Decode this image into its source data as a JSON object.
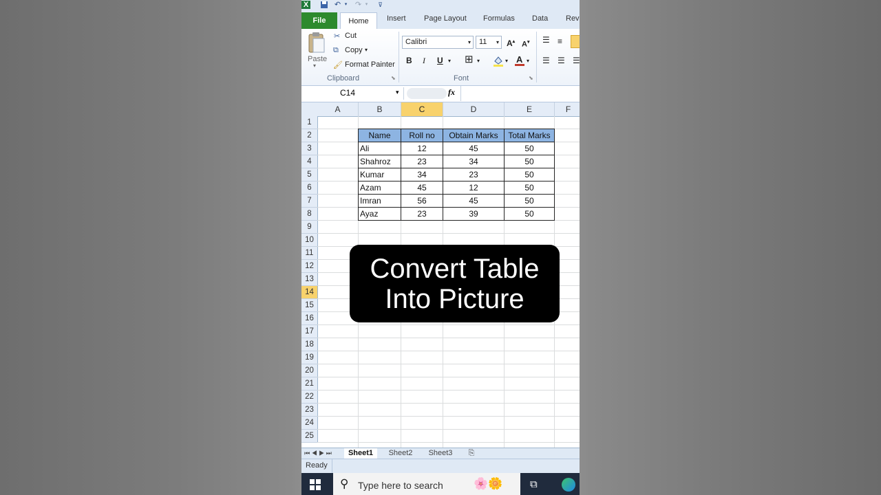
{
  "qat": {
    "save_icon": "save-icon",
    "undo_icon": "undo-icon",
    "redo_icon": "redo-icon",
    "customize_icon": "customize-icon"
  },
  "tabs": {
    "file": "File",
    "home": "Home",
    "insert": "Insert",
    "page_layout": "Page Layout",
    "formulas": "Formulas",
    "data": "Data",
    "review": "Revi"
  },
  "ribbon": {
    "clipboard": {
      "paste": "Paste",
      "cut": "Cut",
      "copy": "Copy",
      "format_painter": "Format Painter",
      "label": "Clipboard"
    },
    "font": {
      "name": "Calibri",
      "size": "11",
      "bold": "B",
      "italic": "I",
      "underline": "U",
      "label": "Font",
      "font_color": "#c0392b",
      "fill_color": "#f7e34c"
    }
  },
  "formula_bar": {
    "name_box": "C14",
    "fx": "fx",
    "formula": ""
  },
  "grid": {
    "columns": [
      "A",
      "B",
      "C",
      "D",
      "E",
      "F"
    ],
    "rows": [
      "1",
      "2",
      "3",
      "4",
      "5",
      "6",
      "7",
      "8",
      "9",
      "10",
      "11",
      "12",
      "13",
      "14",
      "15",
      "16",
      "17",
      "18",
      "19",
      "20",
      "21",
      "22",
      "23",
      "24",
      "25"
    ],
    "selected_column": "C",
    "selected_row": "14",
    "table": {
      "headers": [
        "Name",
        "Roll no",
        "Obtain Marks",
        "Total Marks"
      ],
      "rows": [
        [
          "Ali",
          "12",
          "45",
          "50"
        ],
        [
          "Shahroz",
          "23",
          "34",
          "50"
        ],
        [
          "Kumar",
          "34",
          "23",
          "50"
        ],
        [
          "Azam",
          "45",
          "12",
          "50"
        ],
        [
          "Imran",
          "56",
          "45",
          "50"
        ],
        [
          "Ayaz",
          "23",
          "39",
          "50"
        ]
      ],
      "header_color": "#8db4e2"
    }
  },
  "sheets": [
    "Sheet1",
    "Sheet2",
    "Sheet3"
  ],
  "status": {
    "ready": "Ready"
  },
  "taskbar": {
    "search_placeholder": "Type here to search"
  },
  "overlay": {
    "line1": "Convert Table",
    "line2": "Into Picture"
  }
}
